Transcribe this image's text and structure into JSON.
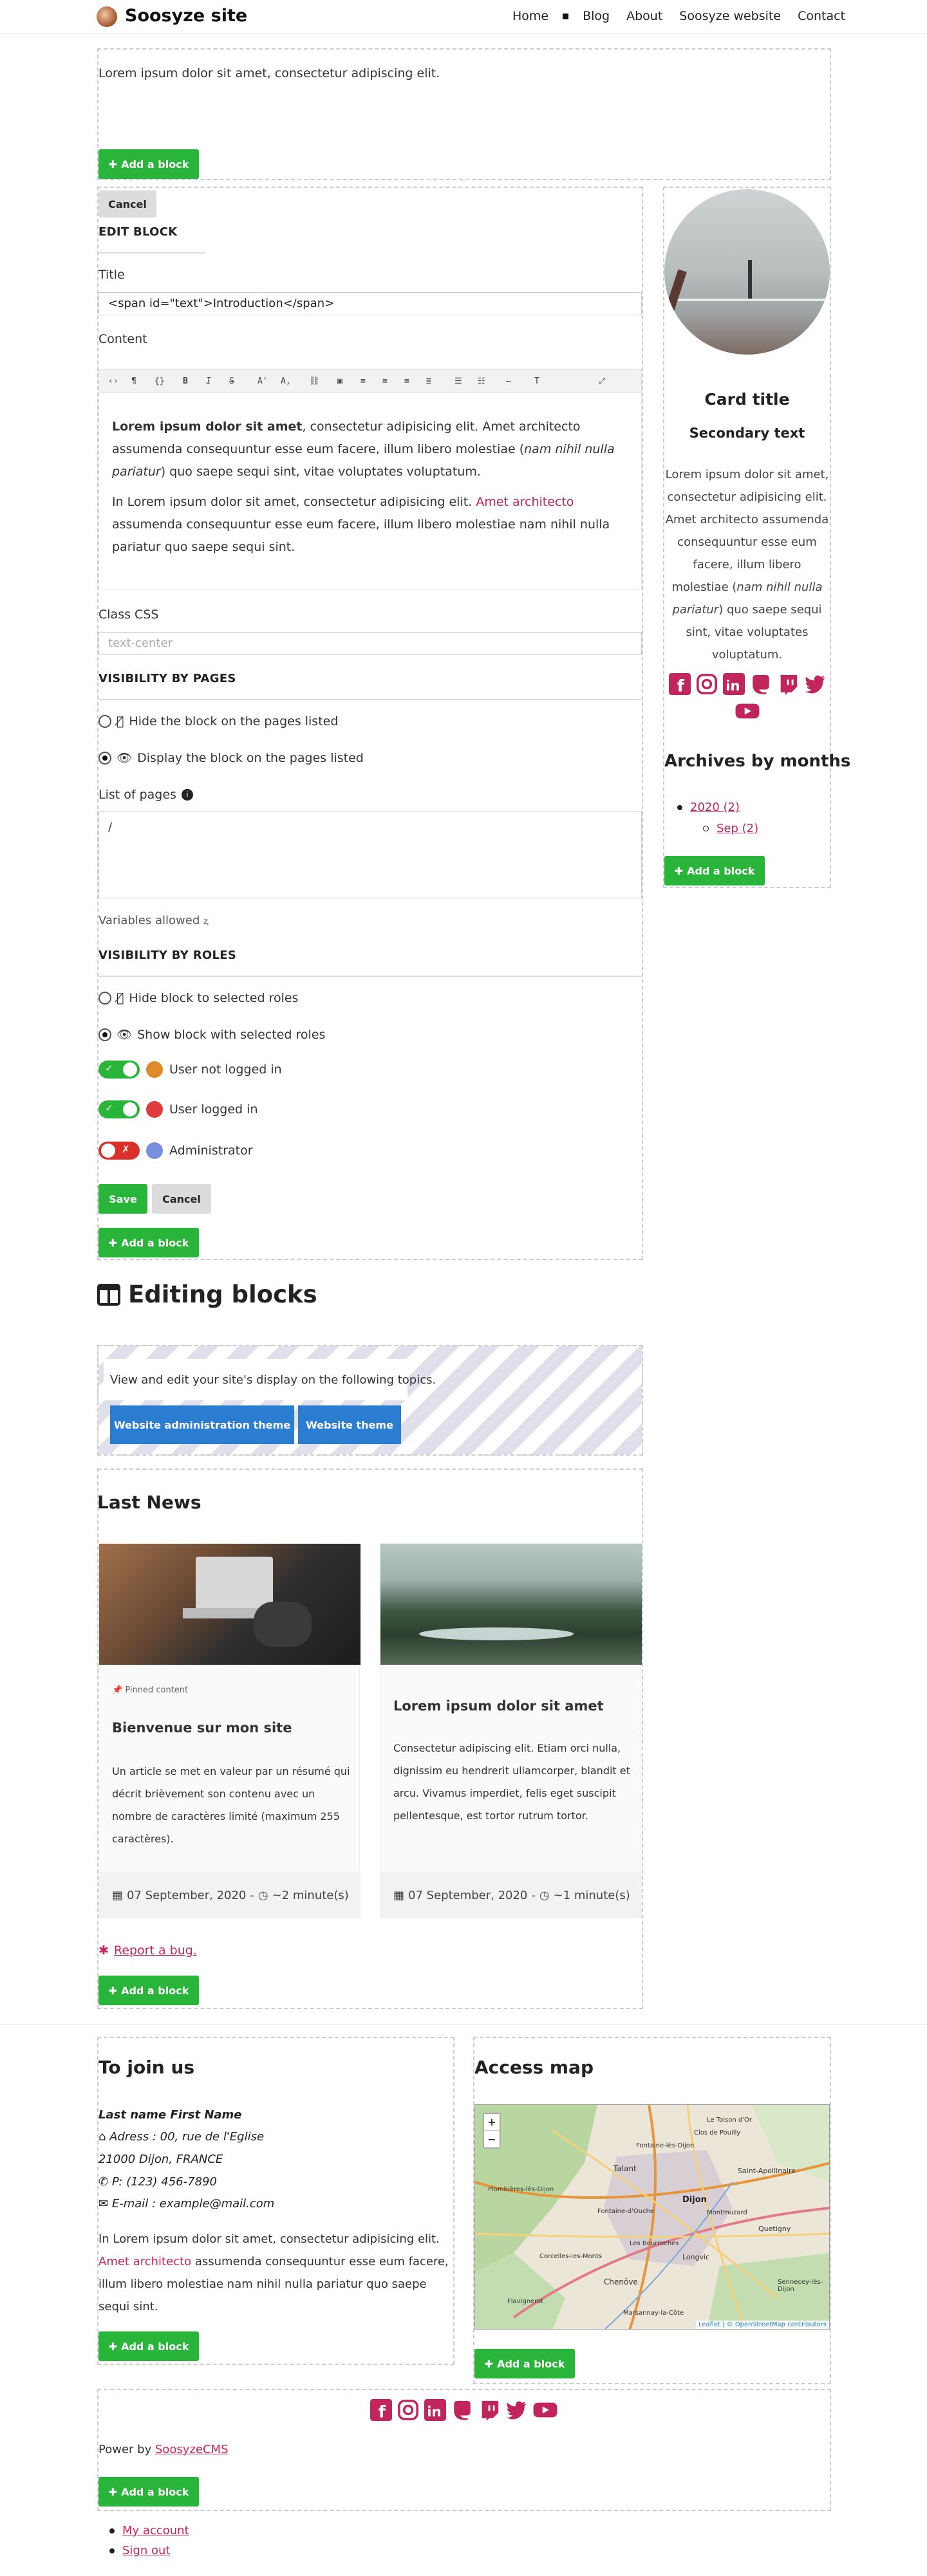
{
  "header": {
    "site_title": "Soosyze site",
    "nav": [
      "Home",
      "Blog",
      "About",
      "Soosyze website",
      "Contact"
    ]
  },
  "top_block": {
    "text": "Lorem ipsum dolor sit amet, consectetur adipiscing elit."
  },
  "common": {
    "add_block": "Add a block",
    "cancel": "Cancel",
    "save": "Save"
  },
  "edit_block": {
    "heading": "EDIT BLOCK",
    "title_label": "Title",
    "title_value": "<span id=\"text\">Introduction</span>",
    "content_label": "Content",
    "content_p1_bold": "Lorem ipsum dolor sit amet",
    "content_p1_rest": ", consectetur adipisicing elit. Amet architecto assumenda consequuntur esse eum facere, illum libero molestiae (",
    "content_p1_italic": "nam nihil nulla pariatur",
    "content_p1_end": ") quo saepe sequi sint, vitae voluptates voluptatum.",
    "content_p2_start": "In Lorem ipsum dolor sit amet, consectetur adipisicing elit. ",
    "content_p2_link": "Amet architecto",
    "content_p2_end": " assumenda consequuntur esse eum facere, illum libero molestiae nam nihil nulla pariatur quo saepe sequi sint.",
    "class_label": "Class CSS",
    "class_placeholder": "text-center",
    "vis_pages_heading": "VISIBILITY BY PAGES",
    "hide_pages": "Hide the block on the pages listed",
    "display_pages": "Display the block on the pages listed",
    "list_pages_label": "List of pages",
    "list_pages_value": "/",
    "variables_allowed": "Variables allowed",
    "vis_roles_heading": "VISIBILITY BY ROLES",
    "hide_roles": "Hide block to selected roles",
    "show_roles": "Show block with selected roles",
    "roles": [
      {
        "label": "User not logged in",
        "on": true,
        "color": "#e08a2a"
      },
      {
        "label": "User logged in",
        "on": true,
        "color": "#e03c3c"
      },
      {
        "label": "Administrator",
        "on": false,
        "color": "#7a8ee0"
      }
    ]
  },
  "sidebar": {
    "card_title": "Card title",
    "card_secondary": "Secondary text",
    "card_p_start": "Lorem ipsum dolor sit amet, consectetur adipisicing elit. Amet architecto assumenda consequuntur esse eum facere, illum libero molestiae (",
    "card_p_italic": "nam nihil nulla pariatur",
    "card_p_end": ") quo saepe sequi sint, vitae voluptates voluptatum.",
    "archives_heading": "Archives by months",
    "archive_year": "2020 (2)",
    "archive_month": "Sep (2)"
  },
  "editing_blocks": {
    "heading": "Editing blocks",
    "text": "View and edit your site's display on the following topics.",
    "btn_admin_theme": "Website administration theme",
    "btn_theme": "Website theme"
  },
  "news": {
    "heading": "Last News",
    "articles": [
      {
        "pinned": "Pinned content",
        "title": "Bienvenue sur mon site",
        "summary": "Un article se met en valeur par un résumé qui décrit brièvement son contenu avec un nombre de caractères limité (maximum 255 caractères).",
        "date": "07 September, 2020",
        "reading": "~2 minute(s)"
      },
      {
        "pinned": "",
        "title": "Lorem ipsum dolor sit amet",
        "summary": "Consectetur adipiscing elit. Etiam orci nulla, dignissim eu hendrerit ullamcorper, blandit et arcu. Vivamus imperdiet, felis eget suscipit pellentesque, est tortor rutrum tortor.",
        "date": "07 September, 2020",
        "reading": "~1 minute(s)"
      }
    ],
    "report_bug": "Report a bug."
  },
  "footer": {
    "join_heading": "To join us",
    "name": "Last name First Name",
    "address": "Adress : 00, rue de l'Eglise",
    "city": "21000 Dijon, FRANCE",
    "phone": "P: (123) 456-7890",
    "email": "E-mail : example@mail.com",
    "join_p_start": "In Lorem ipsum dolor sit amet, consectetur adipisicing elit. ",
    "join_p_link": "Amet architecto",
    "join_p_end": " assumenda consequuntur esse eum facere, illum libero molestiae nam nihil nulla pariatur quo saepe sequi sint.",
    "map_heading": "Access map",
    "map_labels": [
      "Talant",
      "Dijon",
      "Chenôve",
      "Saint-Apollinaire",
      "Fontaine-lès-Dijon",
      "Quetigny",
      "Longvic",
      "Plombières-lès-Dijon",
      "Corcelles-les-Monts",
      "Marsannay-la-Côte",
      "Fontaine-d'Ouche",
      "Les Bourroches",
      "Montmuzard",
      "Clos de Pouilly",
      "Le Toison d'Or",
      "Sennecey-lès-Dijon",
      "Flavignerot"
    ],
    "map_attribution": "Leaflet | © OpenStreetMap contributors",
    "zoom_in": "+",
    "zoom_out": "−",
    "power_by": "Power by",
    "power_link": "SoosyzeCMS",
    "links": [
      "My account",
      "Sign out"
    ]
  },
  "colors": {
    "accent": "#c0255c",
    "green": "#28b53a",
    "blue": "#2a7dd1"
  }
}
